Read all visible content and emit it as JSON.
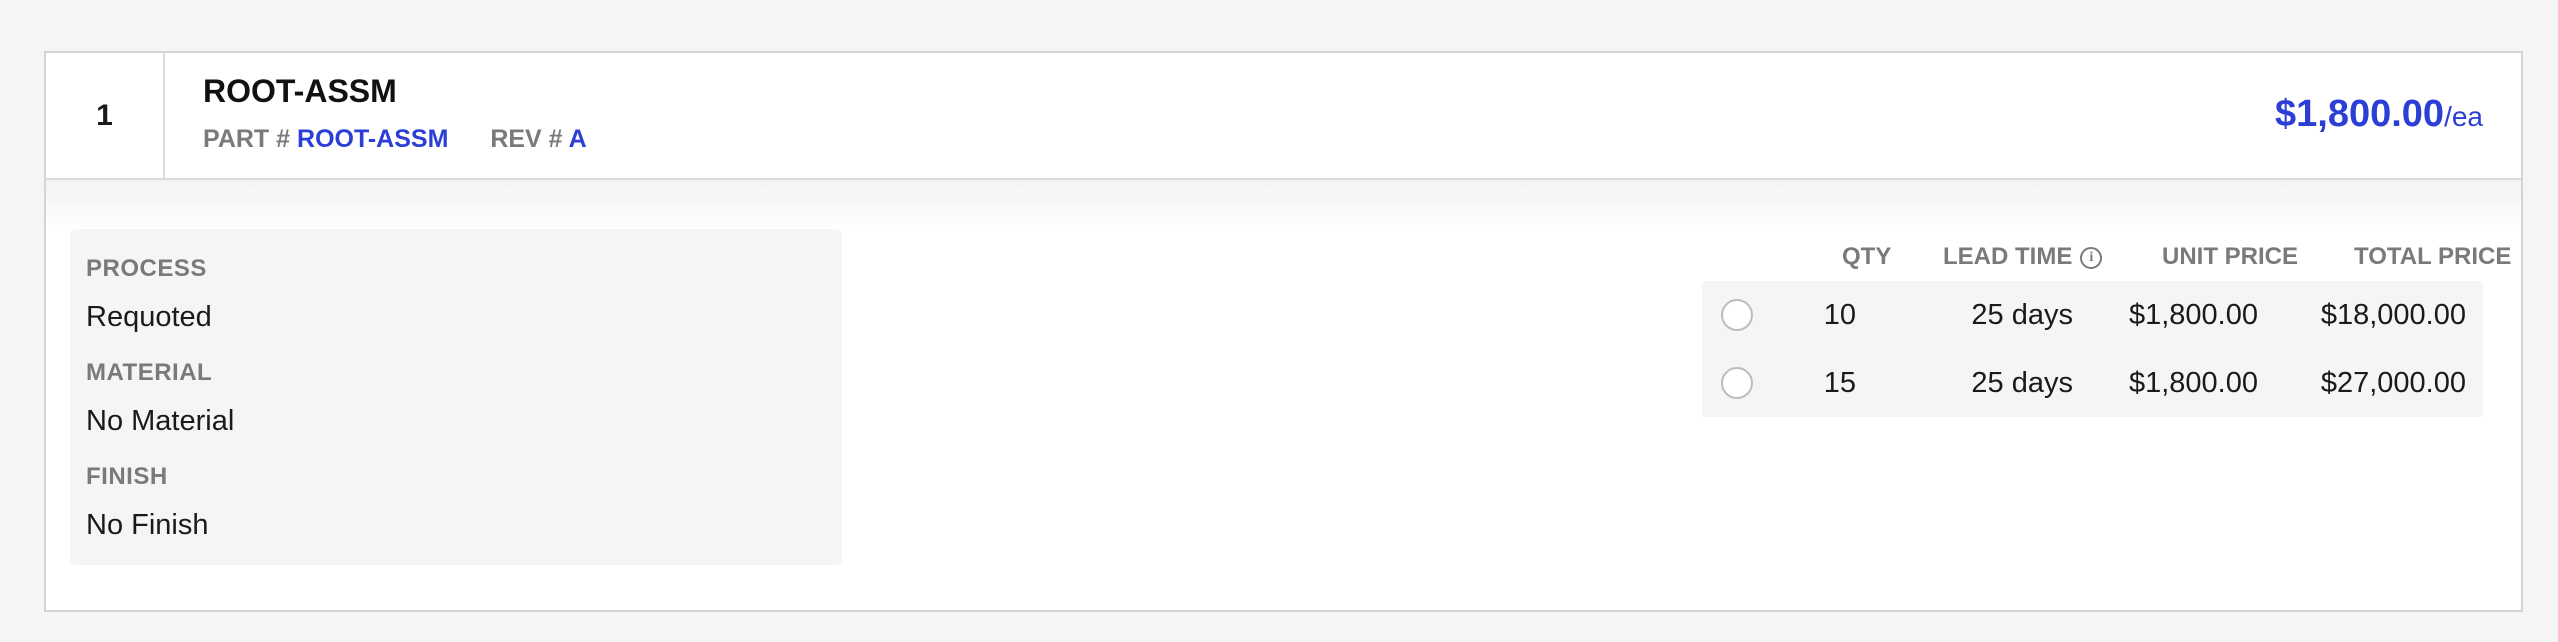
{
  "line_item": {
    "number": "1",
    "title": "ROOT-ASSM",
    "part_label": "PART #",
    "part_number": "ROOT-ASSM",
    "rev_label": "REV #",
    "rev_value": "A",
    "unit_price": "$1,800.00",
    "unit_suffix": "/ea"
  },
  "specs": {
    "process_label": "PROCESS",
    "process_value": "Requoted",
    "material_label": "MATERIAL",
    "material_value": "No Material",
    "finish_label": "FINISH",
    "finish_value": "No Finish"
  },
  "quantity_table": {
    "headers": {
      "qty": "QTY",
      "lead_time": "LEAD TIME",
      "unit_price": "UNIT PRICE",
      "total_price": "TOTAL PRICE"
    },
    "info_icon": "info-icon",
    "rows": [
      {
        "qty": "10",
        "lead_time": "25 days",
        "unit_price": "$1,800.00",
        "total_price": "$18,000.00",
        "selected": false
      },
      {
        "qty": "15",
        "lead_time": "25 days",
        "unit_price": "$1,800.00",
        "total_price": "$27,000.00",
        "selected": false
      }
    ]
  },
  "colors": {
    "accent": "#2b3fd6",
    "muted_label": "#7a7a7a",
    "panel_bg": "#f5f5f5"
  }
}
